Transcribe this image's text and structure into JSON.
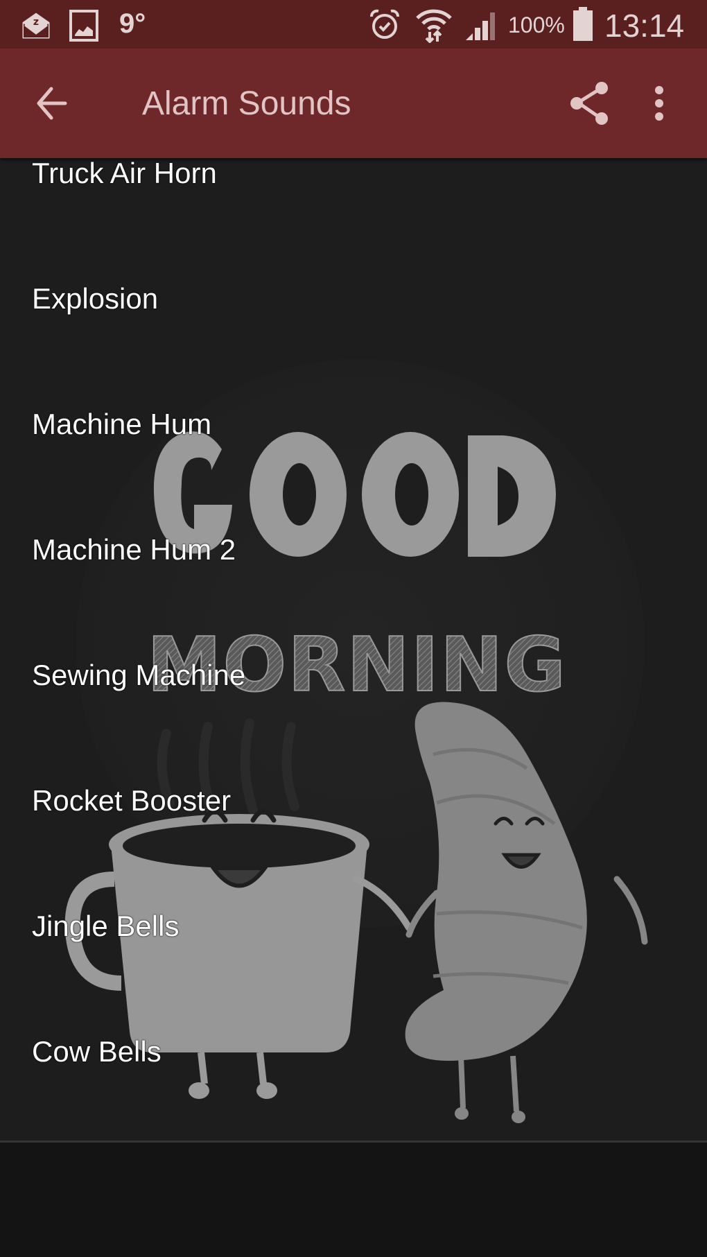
{
  "status_bar": {
    "icons": [
      "email-notification-icon",
      "gallery-icon",
      "alarm-icon",
      "wifi-icon",
      "signal-icon",
      "battery-icon"
    ],
    "temperature": "9°",
    "battery_percent": "100%",
    "time": "13:14"
  },
  "app_bar": {
    "title": "Alarm Sounds",
    "back_icon": "arrow-back-icon",
    "share_icon": "share-icon",
    "more_icon": "more-vertical-icon",
    "background_color": "#6e2829"
  },
  "sounds": [
    {
      "label": "Truck Air Horn"
    },
    {
      "label": "Explosion"
    },
    {
      "label": "Machine Hum"
    },
    {
      "label": "Machine Hum 2"
    },
    {
      "label": "Sewing Machine"
    },
    {
      "label": "Rocket Booster"
    },
    {
      "label": "Jingle Bells"
    },
    {
      "label": "Cow Bells"
    }
  ],
  "background_art": {
    "headline": "GOOD",
    "subheadline": "MORNING"
  }
}
